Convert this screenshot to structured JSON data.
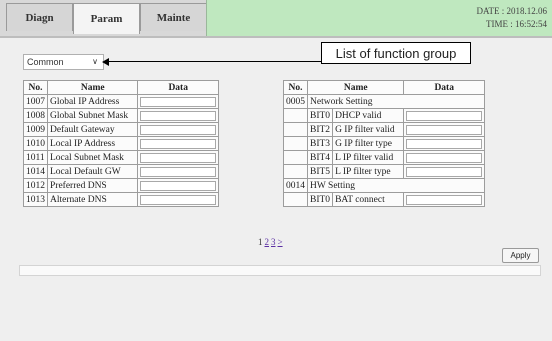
{
  "tabs": [
    {
      "label": "Diagn"
    },
    {
      "label": "Param"
    },
    {
      "label": "Mainte"
    }
  ],
  "status": {
    "date": "DATE : 2018.12.06",
    "time": "TIME : 16:52:54"
  },
  "function_group": {
    "selected": "Common",
    "callout": "List of function group"
  },
  "table_headers": {
    "no": "No.",
    "name": "Name",
    "data": "Data"
  },
  "left_params": [
    {
      "no": "1007",
      "name": "Global IP Address"
    },
    {
      "no": "1008",
      "name": "Global Subnet Mask"
    },
    {
      "no": "1009",
      "name": "Default Gateway"
    },
    {
      "no": "1010",
      "name": "Local IP Address"
    },
    {
      "no": "1011",
      "name": "Local Subnet Mask"
    },
    {
      "no": "1014",
      "name": "Local Default GW"
    },
    {
      "no": "1012",
      "name": "Preferred DNS"
    },
    {
      "no": "1013",
      "name": "Alternate DNS"
    }
  ],
  "right_params": [
    {
      "no": "0005",
      "name": "Network Setting",
      "bits": [
        {
          "bit": "BIT0",
          "name": "DHCP valid"
        },
        {
          "bit": "BIT2",
          "name": "G IP filter valid"
        },
        {
          "bit": "BIT3",
          "name": "G IP filter type"
        },
        {
          "bit": "BIT4",
          "name": "L IP filter valid"
        },
        {
          "bit": "BIT5",
          "name": "L IP filter type"
        }
      ]
    },
    {
      "no": "0014",
      "name": "HW Setting",
      "bits": [
        {
          "bit": "BIT0",
          "name": "BAT connect"
        }
      ]
    }
  ],
  "pagination": {
    "current": "1",
    "pages": [
      "2",
      "3"
    ],
    "next": ">"
  },
  "apply_label": "Apply"
}
